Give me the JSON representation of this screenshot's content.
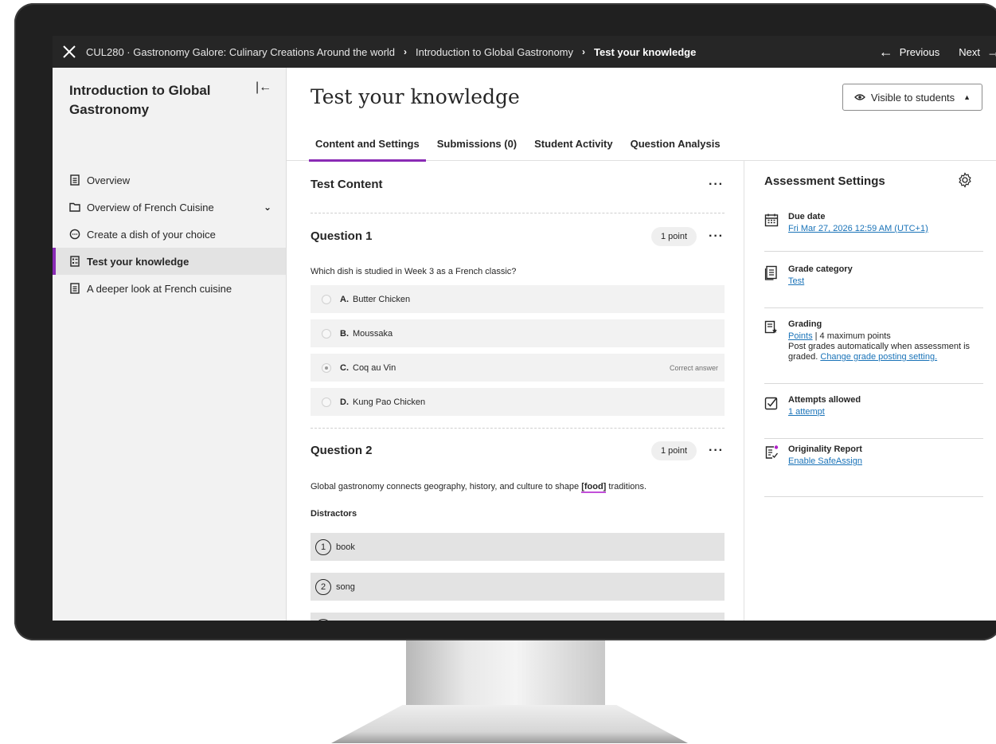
{
  "topbar": {
    "breadcrumbs": [
      "CUL280 · Gastronomy Galore: Culinary Creations Around the world",
      "Introduction to Global Gastronomy",
      "Test your knowledge"
    ],
    "previous_label": "Previous",
    "next_label": "Next"
  },
  "sidebar": {
    "title": "Introduction to Global Gastronomy",
    "items": [
      {
        "label": "Overview",
        "icon": "document-icon"
      },
      {
        "label": "Overview of French Cuisine",
        "icon": "folder-icon"
      },
      {
        "label": "Create a dish of your choice",
        "icon": "discussion-icon"
      },
      {
        "label": "Test your knowledge",
        "icon": "test-icon"
      },
      {
        "label": "A deeper look at French cuisine",
        "icon": "document-icon"
      }
    ]
  },
  "header": {
    "title": "Test your knowledge",
    "visibility_label": "Visible to students"
  },
  "tabs": [
    "Content and Settings",
    "Submissions (0)",
    "Student Activity",
    "Question Analysis"
  ],
  "content": {
    "heading": "Test Content",
    "question1": {
      "title": "Question 1",
      "points": "1 point",
      "text": "Which dish is studied in Week 3 as a French classic?",
      "options": [
        {
          "letter": "A.",
          "text": "Butter Chicken"
        },
        {
          "letter": "B.",
          "text": "Moussaka"
        },
        {
          "letter": "C.",
          "text": "Coq au Vin"
        },
        {
          "letter": "D.",
          "text": "Kung Pao Chicken"
        }
      ],
      "correct_label": "Correct answer"
    },
    "question2": {
      "title": "Question 2",
      "points": "1 point",
      "text_before": "Global gastronomy connects geography, history, and culture to shape ",
      "blank": "[food]",
      "text_after": " traditions.",
      "distractors_label": "Distractors",
      "distractors": [
        {
          "num": "1",
          "text": "book"
        },
        {
          "num": "2",
          "text": "song"
        }
      ]
    }
  },
  "settings": {
    "title": "Assessment Settings",
    "due_date": {
      "label": "Due date",
      "value": "Fri Mar 27, 2026 12:59 AM (UTC+1)"
    },
    "grade_category": {
      "label": "Grade category",
      "value": "Test"
    },
    "grading": {
      "label": "Grading",
      "points_link": "Points",
      "points_rest": " | 4 maximum points",
      "post_text": "Post grades automatically when assessment is graded. ",
      "change_link": "Change grade posting setting."
    },
    "attempts": {
      "label": "Attempts allowed",
      "value": "1 attempt"
    },
    "originality": {
      "label": "Originality Report",
      "value": "Enable SafeAssign"
    }
  }
}
